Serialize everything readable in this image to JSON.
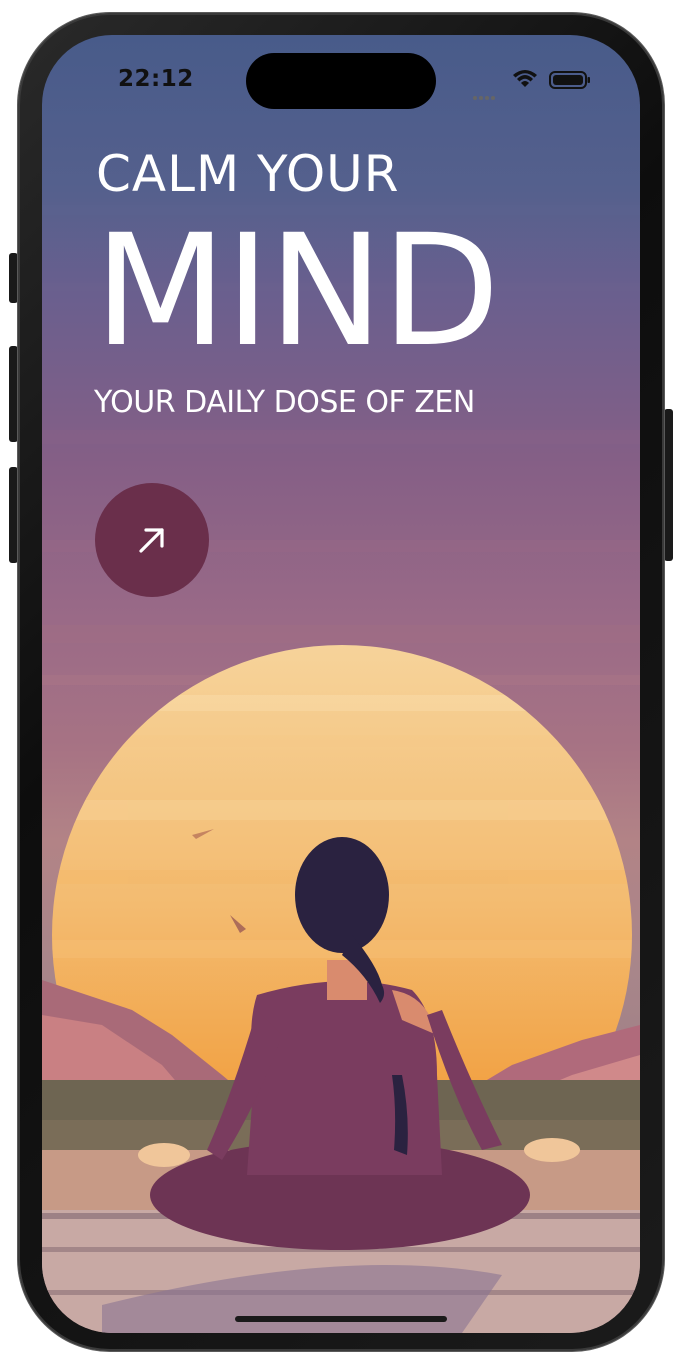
{
  "status_bar": {
    "time": "22:12",
    "icons": [
      "signal-icon",
      "wifi-icon",
      "battery-icon"
    ]
  },
  "hero": {
    "line1": "CALM YOUR",
    "line2": "MIND",
    "tagline": "YOUR DAILY DOSE OF ZEN"
  },
  "actions": {
    "go_button_icon": "arrow-up-right-icon"
  },
  "colors": {
    "sky_top": "#485b8a",
    "sky_mid": "#8a6187",
    "sun": "#f2b266",
    "button": "#6a2f4b",
    "figure": "#7a3a5c",
    "hair": "#2a2240"
  }
}
